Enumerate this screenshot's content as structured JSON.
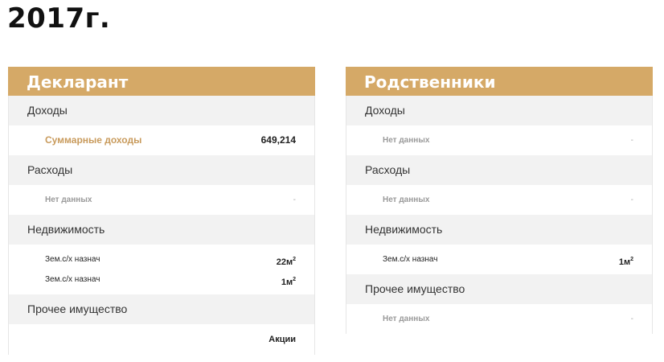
{
  "page": {
    "year": "2017г."
  },
  "declarant": {
    "title": "Декларант",
    "income": {
      "heading": "Доходы",
      "label": "Суммарные доходы",
      "value": "649,214"
    },
    "expenses": {
      "heading": "Расходы",
      "label": "Нет данных",
      "value": "-"
    },
    "realty": {
      "heading": "Недвижимость",
      "items": [
        {
          "label": "Зем.с/х назнач",
          "value": "22м",
          "unit_sup": "2"
        },
        {
          "label": "Зем.с/х назнач",
          "value": "1м",
          "unit_sup": "2"
        }
      ]
    },
    "other": {
      "heading": "Прочее имущество",
      "label": "",
      "value": "Акции"
    }
  },
  "relatives": {
    "title": "Родственники",
    "income": {
      "heading": "Доходы",
      "label": "Нет данных",
      "value": "-"
    },
    "expenses": {
      "heading": "Расходы",
      "label": "Нет данных",
      "value": "-"
    },
    "realty": {
      "heading": "Недвижимость",
      "items": [
        {
          "label": "Зем.с/х назнач",
          "value": "1м",
          "unit_sup": "2"
        }
      ]
    },
    "other": {
      "heading": "Прочее имущество",
      "label": "Нет данных",
      "value": "-"
    }
  }
}
